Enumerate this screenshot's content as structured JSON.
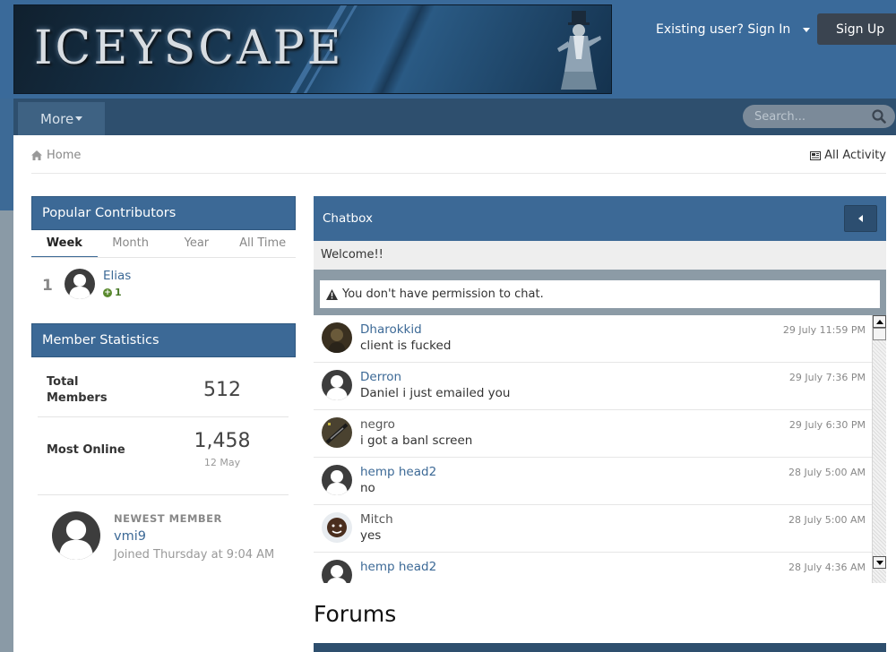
{
  "header": {
    "logo_text": "ICEYSCAPE",
    "sign_in_label": "Existing user? Sign In",
    "sign_up_label": "Sign Up"
  },
  "nav": {
    "more_label": "More",
    "search_placeholder": "Search..."
  },
  "breadcrumb": {
    "home_label": "Home",
    "all_activity_label": "All Activity"
  },
  "popular_contributors": {
    "title": "Popular Contributors",
    "tabs": [
      "Week",
      "Month",
      "Year",
      "All Time"
    ],
    "active_tab": "Week",
    "entries": [
      {
        "rank": "1",
        "name": "Elias",
        "reputation": "1"
      }
    ]
  },
  "member_statistics": {
    "title": "Member Statistics",
    "total_members_label_1": "Total",
    "total_members_label_2": "Members",
    "total_members_value": "512",
    "most_online_label": "Most Online",
    "most_online_value": "1,458",
    "most_online_date": "12 May",
    "newest_member_label": "NEWEST MEMBER",
    "newest_member_name": "vmi9",
    "newest_member_joined": "Joined Thursday at 9:04 AM"
  },
  "chatbox": {
    "title": "Chatbox",
    "welcome": "Welcome!!",
    "permission_notice": "You don't have permission to chat.",
    "messages": [
      {
        "user": "Dharokkid",
        "text": "client is fucked",
        "time": "29 July 11:59 PM",
        "user_link": true,
        "avatar": "photo-dark"
      },
      {
        "user": "Derron",
        "text": "Daniel i just emailed you",
        "time": "29 July 7:36 PM",
        "user_link": true,
        "avatar": "default"
      },
      {
        "user": "negro",
        "text": "i got a banl screen",
        "time": "29 July 6:30 PM",
        "user_link": false,
        "avatar": "photo-weapon"
      },
      {
        "user": "hemp head2",
        "text": "no",
        "time": "28 July 5:00 AM",
        "user_link": true,
        "avatar": "default"
      },
      {
        "user": "Mitch",
        "text": "yes",
        "time": "28 July 5:00 AM",
        "user_link": false,
        "avatar": "photo-face"
      },
      {
        "user": "hemp head2",
        "text": "",
        "time": "28 July 4:36 AM",
        "user_link": true,
        "avatar": "default"
      }
    ]
  },
  "forums": {
    "title": "Forums"
  },
  "colors": {
    "brand_blue": "#3c6996",
    "nav_dark": "#2e4f6e",
    "header_bg": "#3a6a9a"
  }
}
